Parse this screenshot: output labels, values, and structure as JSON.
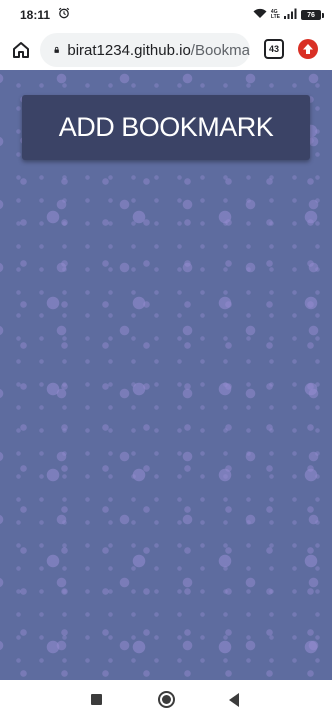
{
  "status_bar": {
    "time": "18:11",
    "network": "4G",
    "lte_top": "4G",
    "lte_bottom": "LTE",
    "battery": "76",
    "icons": [
      "alarm-icon",
      "wifi-icon",
      "signal-icon",
      "battery-icon"
    ]
  },
  "browser": {
    "url_host": "birat1234.github.io",
    "url_path": "/Bookma",
    "tab_count": "43",
    "icons": [
      "home-icon",
      "lock-icon",
      "tabs-icon",
      "update-icon"
    ]
  },
  "page": {
    "add_bookmark_label": "ADD BOOKMARK",
    "background_color": "#5e6c9f",
    "button_color": "#3b4366"
  },
  "nav": {
    "icons": [
      "recents-icon",
      "home-icon",
      "back-icon"
    ]
  }
}
